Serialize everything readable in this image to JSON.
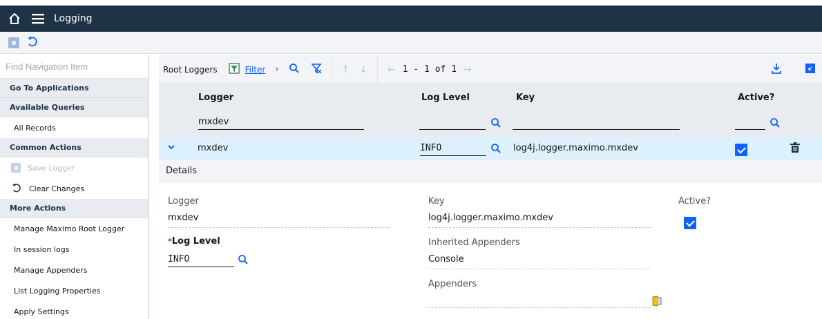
{
  "app": {
    "title": "Logging"
  },
  "sidebar": {
    "search_placeholder": "Find Navigation Item",
    "go_to_applications": "Go To Applications",
    "available_queries": "Available Queries",
    "all_records": "All Records",
    "common_actions": "Common Actions",
    "save_logger": "Save Logger",
    "clear_changes": "Clear Changes",
    "more_actions": "More Actions",
    "more_items": [
      "Manage Maximo Root Logger",
      "In session logs",
      "Manage Appenders",
      "List Logging Properties",
      "Apply Settings"
    ]
  },
  "table": {
    "name": "Root Loggers",
    "filter_label": "Filter",
    "pager": "1 - 1 of 1",
    "columns": {
      "logger": "Logger",
      "log_level": "Log Level",
      "key": "Key",
      "active": "Active?"
    },
    "filter_values": {
      "logger": "mxdev",
      "log_level": "",
      "key": "",
      "active": ""
    },
    "row": {
      "logger": "mxdev",
      "log_level": "INFO",
      "key": "log4j.logger.maximo.mxdev",
      "active": true
    }
  },
  "details": {
    "header": "Details",
    "logger_label": "Logger",
    "logger_value": "mxdev",
    "log_level_label": "Log Level",
    "required_mark": "*",
    "log_level_value": "INFO",
    "key_label": "Key",
    "key_value": "log4j.logger.maximo.mxdev",
    "inherited_label": "Inherited Appenders",
    "inherited_value": "Console",
    "appenders_label": "Appenders",
    "appenders_value": "",
    "active_label": "Active?",
    "active_value": true
  },
  "colors": {
    "topbar": "#1f3347",
    "accent": "#0f62fe",
    "selected_row": "#dcf1fb"
  }
}
